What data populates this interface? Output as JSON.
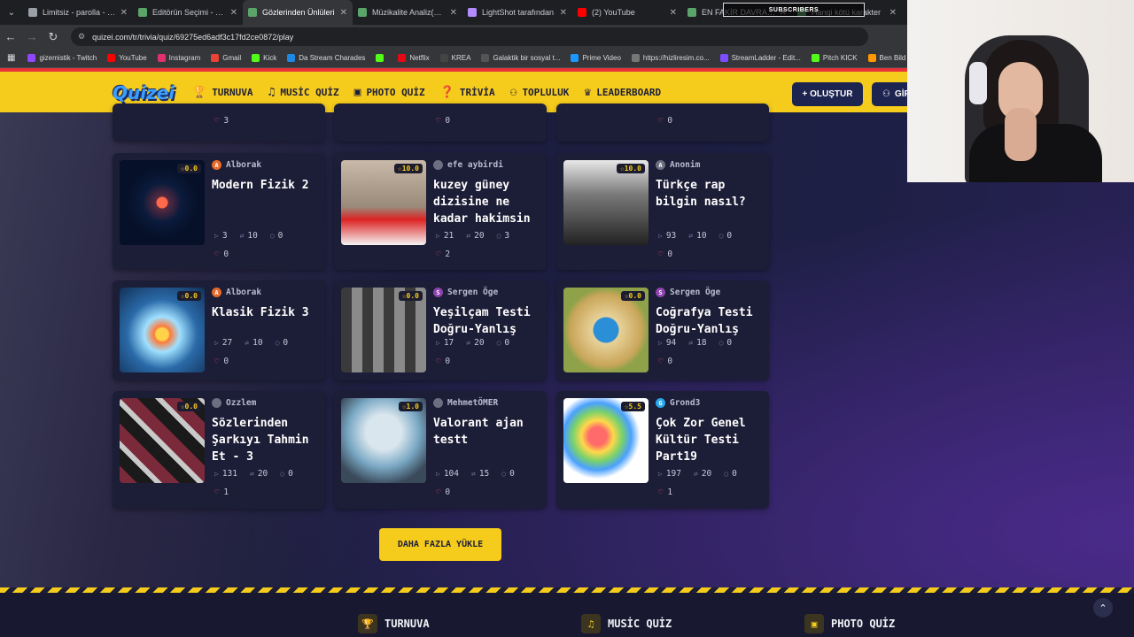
{
  "browser": {
    "tabs": [
      {
        "title": "Limitsiz - parolla - Ke",
        "color": "#9aa0a6",
        "active": false
      },
      {
        "title": "Editörün Seçimi - Tur",
        "color": "#5aa469",
        "active": false
      },
      {
        "title": "Gözlerinden Ünlüleri",
        "color": "#5aa469",
        "active": true
      },
      {
        "title": "Müzikalite Analiz(SAB",
        "color": "#5aa469",
        "active": false
      },
      {
        "title": "LightShot tarafından",
        "color": "#b28cff",
        "active": false
      },
      {
        "title": "(2) YouTube",
        "color": "#ff0000",
        "active": false
      },
      {
        "title": "EN FAKİR DAVRANIŞ",
        "color": "#5aa469",
        "active": false
      },
      {
        "title": "Hangi kötü karakter",
        "color": "#5aa469",
        "active": false
      }
    ],
    "url": "quizei.com/tr/trivia/quiz/69275ed6adf3c17fd2ce0872/play",
    "bookmarks": [
      {
        "label": "gizemistik - Twitch",
        "color": "#9146ff"
      },
      {
        "label": "YouTube",
        "color": "#ff0000"
      },
      {
        "label": "Instagram",
        "color": "#e1306c"
      },
      {
        "label": "Gmail",
        "color": "#ea4335"
      },
      {
        "label": "Kick",
        "color": "#53fc18"
      },
      {
        "label": "Da Stream Charades",
        "color": "#1e88e5"
      },
      {
        "label": "",
        "color": "#53fc18"
      },
      {
        "label": "Netflix",
        "color": "#e50914"
      },
      {
        "label": "KREA",
        "color": "#444444"
      },
      {
        "label": "Galaktik bir sosyal t...",
        "color": "#555555"
      },
      {
        "label": "Prime Video",
        "color": "#1a98ff"
      },
      {
        "label": "https://hizliresim.co...",
        "color": "#777777"
      },
      {
        "label": "StreamLadder - Edit...",
        "color": "#7c4dff"
      },
      {
        "label": "Pitch KICK",
        "color": "#53fc18"
      },
      {
        "label": "Ben Bild",
        "color": "#ff9800"
      }
    ]
  },
  "site": {
    "logo": "Quizei",
    "nav": [
      {
        "label": "TURNUVA",
        "icon": "trophy-icon",
        "glyph": "🏆",
        "active": false
      },
      {
        "label": "MUSİC QUİZ",
        "icon": "music-icon",
        "glyph": "♫",
        "active": false
      },
      {
        "label": "PHOTO QUİZ",
        "icon": "camera-icon",
        "glyph": "▣",
        "active": false
      },
      {
        "label": "TRİVİA",
        "icon": "chat-icon",
        "glyph": "❓",
        "active": true
      },
      {
        "label": "TOPLULUK",
        "icon": "people-icon",
        "glyph": "⚇",
        "active": false
      },
      {
        "label": "LEADERBOARD",
        "icon": "award-icon",
        "glyph": "♛",
        "active": false
      }
    ],
    "create_label": "+ OLUŞTUR",
    "login_label": "GİRİŞ"
  },
  "quizzes": [
    {
      "author": "Alborak",
      "author_color": "#e86a2a",
      "author_initial": "A",
      "title": "Modern Fizik 2",
      "rating": "0.0",
      "plays": "3",
      "questions": "10",
      "comments": "0",
      "likes": "0",
      "thumb": "atom-dark"
    },
    {
      "author": "efe aybirdi",
      "author_color": "#6d6f80",
      "author_initial": "",
      "title": "kuzey güney dizisine ne kadar hakimsin",
      "rating": "10.0",
      "plays": "21",
      "questions": "20",
      "comments": "3",
      "likes": "2",
      "thumb": "kuzey"
    },
    {
      "author": "Anonim",
      "author_color": "#6d6f80",
      "author_initial": "A",
      "title": "Türkçe rap bilgin nasıl?",
      "rating": "10.0",
      "plays": "93",
      "questions": "10",
      "comments": "0",
      "likes": "0",
      "thumb": "rap"
    },
    {
      "author": "Alborak",
      "author_color": "#e86a2a",
      "author_initial": "A",
      "title": "Klasik Fizik 3",
      "rating": "0.0",
      "plays": "27",
      "questions": "10",
      "comments": "0",
      "likes": "0",
      "thumb": "atom-light"
    },
    {
      "author": "Sergen Öge",
      "author_color": "#8e44ad",
      "author_initial": "S",
      "title": "Yeşilçam Testi Doğru-Yanlış",
      "rating": "0.0",
      "plays": "17",
      "questions": "20",
      "comments": "0",
      "likes": "0",
      "thumb": "yesilcam"
    },
    {
      "author": "Sergen Öge",
      "author_color": "#8e44ad",
      "author_initial": "S",
      "title": "Coğrafya Testi Doğru-Yanlış",
      "rating": "0.0",
      "plays": "94",
      "questions": "18",
      "comments": "0",
      "likes": "0",
      "thumb": "compass"
    },
    {
      "author": "Ozzlem",
      "author_color": "#6d6f80",
      "author_initial": "",
      "title": "Sözlerinden Şarkıyı Tahmin Et - 3",
      "rating": "0.0",
      "plays": "131",
      "questions": "20",
      "comments": "0",
      "likes": "1",
      "thumb": "albums"
    },
    {
      "author": "MehmetÖMER",
      "author_color": "#6d6f80",
      "author_initial": "",
      "title": "Valorant ajan testt",
      "rating": "1.0",
      "plays": "104",
      "questions": "15",
      "comments": "0",
      "likes": "0",
      "thumb": "valorant"
    },
    {
      "author": "Grond3",
      "author_color": "#2aa7e8",
      "author_initial": "G",
      "title": "Çok Zor Genel Kültür Testi Part19",
      "rating": "5.5",
      "plays": "197",
      "questions": "20",
      "comments": "0",
      "likes": "1",
      "thumb": "brain"
    }
  ],
  "top_row_likes": [
    "3",
    "0",
    "0"
  ],
  "load_more_label": "DAHA FAZLA YÜKLE",
  "footer": [
    {
      "label": "TURNUVA",
      "icon": "trophy-icon",
      "glyph": "🏆"
    },
    {
      "label": "MUSİC QUİZ",
      "icon": "music-icon",
      "glyph": "♫"
    },
    {
      "label": "PHOTO QUİZ",
      "icon": "camera-icon",
      "glyph": "▣"
    }
  ],
  "overlay": {
    "subscribers_label": "SUBSCRIBERS"
  }
}
